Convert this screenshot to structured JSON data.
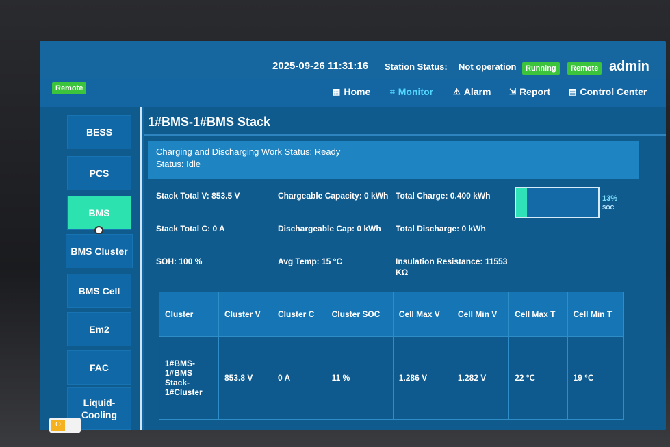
{
  "header": {
    "datetime": "2025-09-26 11:31:16",
    "station_status_label": "Station Status:",
    "station_status_value": "Not operation",
    "running_badge": "Running",
    "remote_badge": "Remote",
    "user": "admin",
    "remote_left_badge": "Remote"
  },
  "nav": {
    "items": [
      {
        "label": "Home",
        "icon": "home-icon"
      },
      {
        "label": "Monitor",
        "icon": "monitor-icon"
      },
      {
        "label": "Alarm",
        "icon": "alarm-icon"
      },
      {
        "label": "Report",
        "icon": "report-icon"
      },
      {
        "label": "Control Center",
        "icon": "control-icon"
      }
    ],
    "active": "Monitor"
  },
  "sidebar": {
    "items": [
      {
        "label": "BESS"
      },
      {
        "label": "PCS"
      },
      {
        "label": "BMS"
      },
      {
        "label": "BMS Cluster"
      },
      {
        "label": "BMS Cell"
      },
      {
        "label": "Em2"
      },
      {
        "label": "FAC"
      },
      {
        "label": "Liquid-Cooling"
      }
    ],
    "active": "BMS"
  },
  "page": {
    "title": "1#BMS-1#BMS Stack",
    "status_line1": "Charging and Discharging Work Status: Ready",
    "status_line2": "Status: Idle"
  },
  "metrics": {
    "stack_total_v": "Stack Total V: 853.5 V",
    "stack_total_c": "Stack Total C: 0 A",
    "soh": "SOH: 100 %",
    "chargeable_capacity": "Chargeable Capacity: 0 kWh",
    "dischargeable_capacity": "Dischargeable Cap: 0 kWh",
    "avg_temp": "Avg Temp: 15 °C",
    "total_charge": "Total Charge: 0.400 kWh",
    "total_discharge": "Total Discharge: 0 kWh",
    "insulation_resistance": "Insulation Resistance: 11553 KΩ"
  },
  "soc": {
    "percent_text": "13%",
    "label": "SOC",
    "fraction": 0.13
  },
  "cluster_table": {
    "headers": [
      "Cluster",
      "Cluster V",
      "Cluster C",
      "Cluster SOC",
      "Cell Max V",
      "Cell Min V",
      "Cell Max T",
      "Cell Min T"
    ],
    "rows": [
      [
        "1#BMS-1#BMS Stack-1#Cluster",
        "853.8 V",
        "0 A",
        "11 %",
        "1.286 V",
        "1.282 V",
        "22 °C",
        "19 °C"
      ]
    ]
  },
  "toggle": {
    "label": "O"
  },
  "colors": {
    "screen_bg": "#1466a3",
    "panel_bg": "#0f5b8e",
    "active_green": "#2ce3b0",
    "badge_green": "#3cc43c",
    "active_nav": "#52d7ff"
  }
}
